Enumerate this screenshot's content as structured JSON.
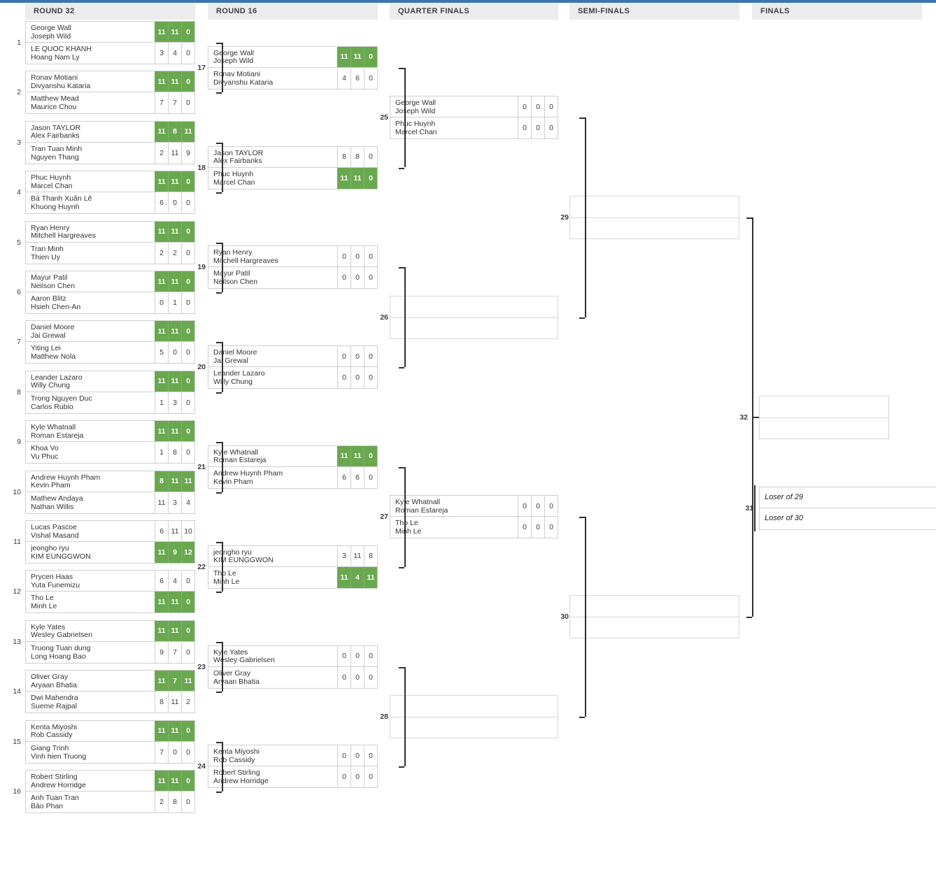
{
  "theme": {
    "accent_bar": "#3b76ae",
    "winner_green": "#69a84f",
    "header_bg": "#ececec"
  },
  "rounds": [
    {
      "label": "ROUND 32"
    },
    {
      "label": "ROUND 16"
    },
    {
      "label": "QUARTER FINALS"
    },
    {
      "label": "SEMI-FINALS"
    },
    {
      "label": "FINALS"
    }
  ],
  "seeds": [
    "1",
    "2",
    "3",
    "4",
    "5",
    "6",
    "7",
    "8",
    "9",
    "10",
    "11",
    "12",
    "13",
    "14",
    "15",
    "16"
  ],
  "matches": {
    "r32": [
      {
        "no": "1",
        "top": {
          "p1": "George Wall",
          "p2": "Joseph Wild",
          "scores": [
            "11",
            "11",
            "0"
          ],
          "win": true
        },
        "bot": {
          "p1": "LE QUOC KHANH",
          "p2": "Hoang Nam Ly",
          "scores": [
            "3",
            "4",
            "0"
          ],
          "win": false
        }
      },
      {
        "no": "2",
        "top": {
          "p1": "Ronav Motiani",
          "p2": "Divyanshu Kataria",
          "scores": [
            "11",
            "11",
            "0"
          ],
          "win": true
        },
        "bot": {
          "p1": "Matthew Mead",
          "p2": "Maurice Chou",
          "scores": [
            "7",
            "7",
            "0"
          ],
          "win": false
        }
      },
      {
        "no": "3",
        "top": {
          "p1": "Jason TAYLOR",
          "p2": "Alex Fairbanks",
          "scores": [
            "11",
            "8",
            "11"
          ],
          "win": true
        },
        "bot": {
          "p1": "Tran Tuan Minh",
          "p2": "Nguyen Thang",
          "scores": [
            "2",
            "11",
            "9"
          ],
          "win": false
        }
      },
      {
        "no": "4",
        "top": {
          "p1": "Phuc Huynh",
          "p2": "Marcel Chan",
          "scores": [
            "11",
            "11",
            "0"
          ],
          "win": true
        },
        "bot": {
          "p1": "Bá Thanh Xuân Lê",
          "p2": "Khuong Huynh",
          "scores": [
            "6",
            "0",
            "0"
          ],
          "win": false
        }
      },
      {
        "no": "5",
        "top": {
          "p1": "Ryan Henry",
          "p2": "Mitchell Hargreaves",
          "scores": [
            "11",
            "11",
            "0"
          ],
          "win": true
        },
        "bot": {
          "p1": "Tran Minh",
          "p2": "Thien Uy",
          "scores": [
            "2",
            "2",
            "0"
          ],
          "win": false
        }
      },
      {
        "no": "6",
        "top": {
          "p1": "Mayur Patil",
          "p2": "Neilson Chen",
          "scores": [
            "11",
            "11",
            "0"
          ],
          "win": true
        },
        "bot": {
          "p1": "Aaron Blitz",
          "p2": "Hsieh Chen-An",
          "scores": [
            "0",
            "1",
            "0"
          ],
          "win": false
        }
      },
      {
        "no": "7",
        "top": {
          "p1": "Daniel Moore",
          "p2": "Jai Grewal",
          "scores": [
            "11",
            "11",
            "0"
          ],
          "win": true
        },
        "bot": {
          "p1": "Yiting Lei",
          "p2": "Matthew Nola",
          "scores": [
            "5",
            "0",
            "0"
          ],
          "win": false
        }
      },
      {
        "no": "8",
        "top": {
          "p1": "Leander Lazaro",
          "p2": "Willy Chung",
          "scores": [
            "11",
            "11",
            "0"
          ],
          "win": true
        },
        "bot": {
          "p1": "Trong Nguyen Duc",
          "p2": "Carlos Rubio",
          "scores": [
            "1",
            "3",
            "0"
          ],
          "win": false
        }
      },
      {
        "no": "9",
        "top": {
          "p1": "Kyle Whatnall",
          "p2": "Roman Estareja",
          "scores": [
            "11",
            "11",
            "0"
          ],
          "win": true
        },
        "bot": {
          "p1": "Khoa Vo",
          "p2": "Vu Phuc",
          "scores": [
            "1",
            "8",
            "0"
          ],
          "win": false
        }
      },
      {
        "no": "10",
        "top": {
          "p1": "Andrew Huynh Pham",
          "p2": "Kevin Pham",
          "scores": [
            "8",
            "11",
            "11"
          ],
          "win": true
        },
        "bot": {
          "p1": "Mathew Andaya",
          "p2": "Nathan Willis",
          "scores": [
            "11",
            "3",
            "4"
          ],
          "win": false
        }
      },
      {
        "no": "11",
        "top": {
          "p1": "Lucas Pascoe",
          "p2": "Vishal Masand",
          "scores": [
            "6",
            "11",
            "10"
          ],
          "win": false
        },
        "bot": {
          "p1": "jeongho ryu",
          "p2": "KIM EUNGGWON",
          "scores": [
            "11",
            "9",
            "12"
          ],
          "win": true
        }
      },
      {
        "no": "12",
        "top": {
          "p1": "Prycen Haas",
          "p2": "Yuta Funemizu",
          "scores": [
            "6",
            "4",
            "0"
          ],
          "win": false
        },
        "bot": {
          "p1": "Tho Le",
          "p2": "Minh Le",
          "scores": [
            "11",
            "11",
            "0"
          ],
          "win": true
        }
      },
      {
        "no": "13",
        "top": {
          "p1": "Kyle Yates",
          "p2": "Wesley Gabrielsen",
          "scores": [
            "11",
            "11",
            "0"
          ],
          "win": true
        },
        "bot": {
          "p1": "Truong Tuan dung",
          "p2": "Long Hoang Bao",
          "scores": [
            "9",
            "7",
            "0"
          ],
          "win": false
        }
      },
      {
        "no": "14",
        "top": {
          "p1": "Oliver Gray",
          "p2": "Aryaan Bhatia",
          "scores": [
            "11",
            "7",
            "11"
          ],
          "win": true
        },
        "bot": {
          "p1": "Dwi Mahendra",
          "p2": "Sueme Rajpal",
          "scores": [
            "8",
            "11",
            "2"
          ],
          "win": false
        }
      },
      {
        "no": "15",
        "top": {
          "p1": "Kenta Miyoshi",
          "p2": "Rob Cassidy",
          "scores": [
            "11",
            "11",
            "0"
          ],
          "win": true
        },
        "bot": {
          "p1": "Giang Trinh",
          "p2": "Vinh hien Truong",
          "scores": [
            "7",
            "0",
            "0"
          ],
          "win": false
        }
      },
      {
        "no": "16",
        "top": {
          "p1": "Robert Stirling",
          "p2": "Andrew Horridge",
          "scores": [
            "11",
            "11",
            "0"
          ],
          "win": true
        },
        "bot": {
          "p1": "Anh Tuan Tran",
          "p2": "Bảo Phan",
          "scores": [
            "2",
            "8",
            "0"
          ],
          "win": false
        }
      }
    ],
    "r16": [
      {
        "no": "17",
        "top": {
          "p1": "George Wall",
          "p2": "Joseph Wild",
          "scores": [
            "11",
            "11",
            "0"
          ],
          "win": true
        },
        "bot": {
          "p1": "Ronav Motiani",
          "p2": "Divyanshu Kataria",
          "scores": [
            "4",
            "6",
            "0"
          ],
          "win": false
        }
      },
      {
        "no": "18",
        "top": {
          "p1": "Jason TAYLOR",
          "p2": "Alex Fairbanks",
          "scores": [
            "8",
            "8",
            "0"
          ],
          "win": false
        },
        "bot": {
          "p1": "Phuc Huynh",
          "p2": "Marcel Chan",
          "scores": [
            "11",
            "11",
            "0"
          ],
          "win": true
        }
      },
      {
        "no": "19",
        "top": {
          "p1": "Ryan Henry",
          "p2": "Mitchell Hargreaves",
          "scores": [
            "0",
            "0",
            "0"
          ],
          "win": false
        },
        "bot": {
          "p1": "Mayur Patil",
          "p2": "Neilson Chen",
          "scores": [
            "0",
            "0",
            "0"
          ],
          "win": false
        }
      },
      {
        "no": "20",
        "top": {
          "p1": "Daniel Moore",
          "p2": "Jai Grewal",
          "scores": [
            "0",
            "0",
            "0"
          ],
          "win": false
        },
        "bot": {
          "p1": "Leander Lazaro",
          "p2": "Willy Chung",
          "scores": [
            "0",
            "0",
            "0"
          ],
          "win": false
        }
      },
      {
        "no": "21",
        "top": {
          "p1": "Kyle Whatnall",
          "p2": "Roman Estareja",
          "scores": [
            "11",
            "11",
            "0"
          ],
          "win": true
        },
        "bot": {
          "p1": "Andrew Huynh Pham",
          "p2": "Kevin Pham",
          "scores": [
            "6",
            "6",
            "0"
          ],
          "win": false
        }
      },
      {
        "no": "22",
        "top": {
          "p1": "jeongho ryu",
          "p2": "KIM EUNGGWON",
          "scores": [
            "3",
            "11",
            "8"
          ],
          "win": false
        },
        "bot": {
          "p1": "Tho Le",
          "p2": "Minh Le",
          "scores": [
            "11",
            "4",
            "11"
          ],
          "win": true
        }
      },
      {
        "no": "23",
        "top": {
          "p1": "Kyle Yates",
          "p2": "Wesley Gabrielsen",
          "scores": [
            "0",
            "0",
            "0"
          ],
          "win": false
        },
        "bot": {
          "p1": "Oliver Gray",
          "p2": "Aryaan Bhatia",
          "scores": [
            "0",
            "0",
            "0"
          ],
          "win": false
        }
      },
      {
        "no": "24",
        "top": {
          "p1": "Kenta Miyoshi",
          "p2": "Rob Cassidy",
          "scores": [
            "0",
            "0",
            "0"
          ],
          "win": false
        },
        "bot": {
          "p1": "Robert Stirling",
          "p2": "Andrew Horridge",
          "scores": [
            "0",
            "0",
            "0"
          ],
          "win": false
        }
      }
    ],
    "qf": [
      {
        "no": "25",
        "top": {
          "p1": "George Wall",
          "p2": "Joseph Wild",
          "scores": [
            "0",
            "0",
            "0"
          ],
          "win": false
        },
        "bot": {
          "p1": "Phuc Huynh",
          "p2": "Marcel Chan",
          "scores": [
            "0",
            "0",
            "0"
          ],
          "win": false
        }
      },
      {
        "no": "26",
        "empty": true
      },
      {
        "no": "27",
        "top": {
          "p1": "Kyle Whatnall",
          "p2": "Roman Estareja",
          "scores": [
            "0",
            "0",
            "0"
          ],
          "win": false
        },
        "bot": {
          "p1": "Tho Le",
          "p2": "Minh Le",
          "scores": [
            "0",
            "0",
            "0"
          ],
          "win": false
        }
      },
      {
        "no": "28",
        "empty": true
      }
    ],
    "sf": [
      {
        "no": "29",
        "empty": true
      },
      {
        "no": "30",
        "empty": true
      }
    ],
    "finals": [
      {
        "no": "32",
        "empty": true
      },
      {
        "no": "31",
        "top": {
          "p1": "Loser of 29",
          "p2": "",
          "italic": true
        },
        "bot": {
          "p1": "Loser of 30",
          "p2": "",
          "italic": true
        }
      }
    ]
  }
}
